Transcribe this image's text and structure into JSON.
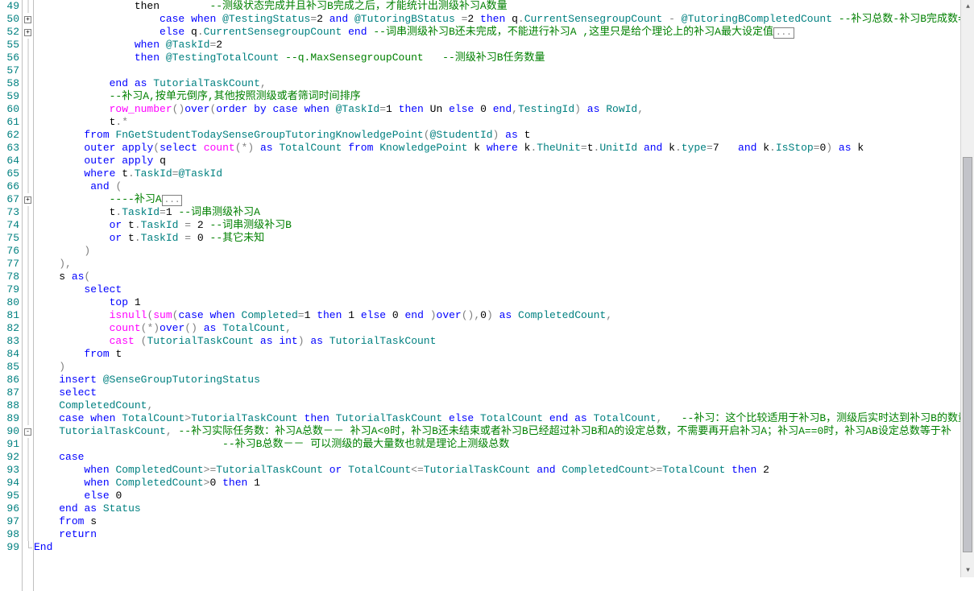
{
  "line_numbers": [
    "49",
    "50",
    "52",
    "55",
    "56",
    "57",
    "58",
    "59",
    "60",
    "61",
    "62",
    "63",
    "64",
    "65",
    "66",
    "67",
    "73",
    "74",
    "75",
    "76",
    "77",
    "78",
    "79",
    "80",
    "81",
    "82",
    "83",
    "84",
    "85",
    "86",
    "87",
    "88",
    "89",
    "90",
    "91",
    "92",
    "93",
    "94",
    "95",
    "96",
    "97",
    "98",
    "99"
  ],
  "fold": {
    "50": "plus",
    "52": "plus",
    "67": "plus",
    "90": "minus"
  },
  "code": {
    "l49": {
      "pre": "                then        ",
      "c1": "--测级状态完成并且补习B完成之后，才能统计出测级补习A数量"
    },
    "l50": {
      "pre": "                    ",
      "k1": "case",
      "t1": " ",
      "k2": "when",
      "t2": " ",
      "v1": "@TestingStatus",
      "o1": "=",
      "n1": "2",
      "t3": " ",
      "k3": "and",
      "t4": " ",
      "v2": "@TutoringBStatus",
      "t5": " ",
      "o2": "=",
      "n2": "2",
      "t6": " ",
      "k4": "then",
      "t7": " q",
      "o3": ".",
      "i1": "CurrentSensegroupCount",
      "t8": " ",
      "o4": "-",
      "t9": " ",
      "v3": "@TutoringBCompletedCount",
      "t10": " ",
      "c1": "--补习总数-补习B完成数= 测级补习A需要补"
    },
    "l52": {
      "pre": "                    ",
      "k1": "else",
      "t1": " q",
      "o1": ".",
      "i1": "CurrentSensegroupCount",
      "t2": " ",
      "k2": "end",
      "t3": " ",
      "c1": "--词串测级补习B还未完成，不能进行补习A ,这里只是给个理论上的补习A最大设定值",
      "box": "..."
    },
    "l55": {
      "pre": "                ",
      "k1": "when",
      "t1": " ",
      "v1": "@TaskId",
      "o1": "=",
      "n1": "2"
    },
    "l56": {
      "pre": "                ",
      "k1": "then",
      "t1": " ",
      "v1": "@TestingTotalCount",
      "t2": " ",
      "c1": "--q.MaxSensegroupCount   --测级补习B任务数量"
    },
    "l58": {
      "pre": "            ",
      "k1": "end",
      "t1": " ",
      "k2": "as",
      "t2": " ",
      "i1": "TutorialTaskCount",
      "o1": ","
    },
    "l59": {
      "pre": "            ",
      "c1": "--补习A,按单元倒序,其他按照测级或者筛词时间排序"
    },
    "l60": {
      "pre": "            ",
      "f1": "row_number",
      "o1": "()",
      "k1": "over",
      "o2": "(",
      "k2": "order",
      "t1": " ",
      "k3": "by",
      "t2": " ",
      "k4": "case",
      "t3": " ",
      "k5": "when",
      "t4": " ",
      "v1": "@TaskId",
      "o3": "=",
      "n1": "1",
      "t5": " ",
      "k6": "then",
      "t6": " Un ",
      "k7": "else",
      "t7": " ",
      "n2": "0",
      "t8": " ",
      "k8": "end",
      "o4": ",",
      "i1": "TestingId",
      "o5": ")",
      "t9": " ",
      "k9": "as",
      "t10": " ",
      "i2": "RowId",
      "o6": ","
    },
    "l61": {
      "pre": "            t",
      "o1": ".*"
    },
    "l62": {
      "pre": "        ",
      "k1": "from",
      "t1": " ",
      "i1": "FnGetStudentTodaySenseGroupTutoringKnowledgePoint",
      "o1": "(",
      "v1": "@StudentId",
      "o2": ")",
      "t2": " ",
      "k2": "as",
      "t3": " t"
    },
    "l63": {
      "pre": "        ",
      "k1": "outer",
      "t1": " ",
      "k2": "apply",
      "o1": "(",
      "k3": "select",
      "t2": " ",
      "f1": "count",
      "o2": "(*)",
      "t3": " ",
      "k4": "as",
      "t4": " ",
      "i1": "TotalCount",
      "t5": " ",
      "k5": "from",
      "t6": " ",
      "i2": "KnowledgePoint",
      "t7": " k ",
      "k6": "where",
      "t8": " k",
      "o3": ".",
      "i3": "TheUnit",
      "o4": "=",
      "t9": "t",
      "o5": ".",
      "i4": "UnitId",
      "t10": " ",
      "k7": "and",
      "t11": " k",
      "o6": ".",
      "i5": "type",
      "o7": "=",
      "n1": "7",
      "t12": "   ",
      "k8": "and",
      "t13": " k",
      "o8": ".",
      "i6": "IsStop",
      "o9": "=",
      "n2": "0",
      "o10": ")",
      "t14": " ",
      "k9": "as",
      "t15": " k"
    },
    "l64": {
      "pre": "        ",
      "k1": "outer",
      "t1": " ",
      "k2": "apply",
      "t2": " q"
    },
    "l65": {
      "pre": "        ",
      "k1": "where",
      "t1": " t",
      "o1": ".",
      "i1": "TaskId",
      "o2": "=",
      "v1": "@TaskId"
    },
    "l66": {
      "pre": "         ",
      "k1": "and",
      "t1": " ",
      "o1": "("
    },
    "l67": {
      "pre": "            ",
      "c1": "----补习A",
      "box": "..."
    },
    "l73": {
      "pre": "            t",
      "o1": ".",
      "i1": "TaskId",
      "o2": "=",
      "n1": "1",
      "t1": " ",
      "c1": "--词串测级补习A"
    },
    "l74": {
      "pre": "            ",
      "k1": "or",
      "t1": " t",
      "o1": ".",
      "i1": "TaskId",
      "t2": " ",
      "o2": "=",
      "t3": " ",
      "n1": "2",
      "t4": " ",
      "c1": "--词串测级补习B"
    },
    "l75": {
      "pre": "            ",
      "k1": "or",
      "t1": " t",
      "o1": ".",
      "i1": "TaskId",
      "t2": " ",
      "o2": "=",
      "t3": " ",
      "n1": "0",
      "t4": " ",
      "c1": "--其它未知"
    },
    "l76": {
      "pre": "        ",
      "o1": ")"
    },
    "l77": {
      "pre": "    ",
      "o1": "),"
    },
    "l78": {
      "pre": "    s ",
      "k1": "as",
      "o1": "("
    },
    "l79": {
      "pre": "        ",
      "k1": "select"
    },
    "l80": {
      "pre": "            ",
      "k1": "top",
      "t1": " ",
      "n1": "1"
    },
    "l81": {
      "pre": "            ",
      "f1": "isnull",
      "o1": "(",
      "f2": "sum",
      "o2": "(",
      "k1": "case",
      "t1": " ",
      "k2": "when",
      "t2": " ",
      "i1": "Completed",
      "o3": "=",
      "n1": "1",
      "t3": " ",
      "k3": "then",
      "t4": " ",
      "n2": "1",
      "t5": " ",
      "k4": "else",
      "t6": " ",
      "n3": "0",
      "t7": " ",
      "k5": "end",
      "t8": " ",
      "o4": ")",
      "k6": "over",
      "o5": "(),",
      "n4": "0",
      "o6": ")",
      "t9": " ",
      "k7": "as",
      "t10": " ",
      "i2": "CompletedCount",
      "o7": ","
    },
    "l82": {
      "pre": "            ",
      "f1": "count",
      "o1": "(*)",
      "k1": "over",
      "o2": "()",
      "t1": " ",
      "k2": "as",
      "t2": " ",
      "i1": "TotalCount",
      "o3": ","
    },
    "l83": {
      "pre": "            ",
      "f1": "cast",
      "t1": " ",
      "o1": "(",
      "i1": "TutorialTaskCount",
      "t2": " ",
      "k1": "as",
      "t3": " ",
      "k2": "int",
      "o2": ")",
      "t4": " ",
      "k3": "as",
      "t5": " ",
      "i2": "TutorialTaskCount"
    },
    "l84": {
      "pre": "        ",
      "k1": "from",
      "t1": " t"
    },
    "l85": {
      "pre": "    ",
      "o1": ")"
    },
    "l86": {
      "pre": "    ",
      "k1": "insert",
      "t1": " ",
      "v1": "@SenseGroupTutoringStatus"
    },
    "l87": {
      "pre": "    ",
      "k1": "select"
    },
    "l88": {
      "pre": "    ",
      "i1": "CompletedCount",
      "o1": ","
    },
    "l89": {
      "pre": "    ",
      "k1": "case",
      "t1": " ",
      "k2": "when",
      "t2": " ",
      "i1": "TotalCount",
      "o1": ">",
      "i2": "TutorialTaskCount",
      "t3": " ",
      "k3": "then",
      "t4": " ",
      "i3": "TutorialTaskCount",
      "t5": " ",
      "k4": "else",
      "t6": " ",
      "i4": "TotalCount",
      "t7": " ",
      "k5": "end",
      "t8": " ",
      "k6": "as",
      "t9": " ",
      "i5": "TotalCount",
      "o2": ",",
      "t10": "   ",
      "c1": "--补习：这个比较适用于补习B，测级后实时达到补习B的数量，包括任务"
    },
    "l90": {
      "pre": "    ",
      "i1": "TutorialTaskCount",
      "o1": ",",
      "t1": " ",
      "c1": "--补习实际任务数：补习A总数－－ 补习A<0时，补习B还未结束或者补习B已经超过补习B和A的设定总数，不需要再开启补习A；补习A==0时，补习AB设定总数等于补"
    },
    "l91": {
      "pre": "                              ",
      "c1": "--补习B总数－－ 可以测级的最大量数也就是理论上测级总数"
    },
    "l92": {
      "pre": "    ",
      "k1": "case"
    },
    "l93": {
      "pre": "        ",
      "k1": "when",
      "t1": " ",
      "i1": "CompletedCount",
      "o1": ">=",
      "i2": "TutorialTaskCount",
      "t2": " ",
      "k2": "or",
      "t3": " ",
      "i3": "TotalCount",
      "o2": "<=",
      "i4": "TutorialTaskCount",
      "t4": " ",
      "k3": "and",
      "t5": " ",
      "i5": "CompletedCount",
      "o3": ">=",
      "i6": "TotalCount",
      "t6": " ",
      "k4": "then",
      "t7": " ",
      "n1": "2"
    },
    "l94": {
      "pre": "        ",
      "k1": "when",
      "t1": " ",
      "i1": "CompletedCount",
      "o1": ">",
      "n1": "0",
      "t2": " ",
      "k2": "then",
      "t3": " ",
      "n2": "1"
    },
    "l95": {
      "pre": "        ",
      "k1": "else",
      "t1": " ",
      "n1": "0"
    },
    "l96": {
      "pre": "    ",
      "k1": "end",
      "t1": " ",
      "k2": "as",
      "t2": " ",
      "i1": "Status"
    },
    "l97": {
      "pre": "    ",
      "k1": "from",
      "t1": " s"
    },
    "l98": {
      "pre": "    ",
      "k1": "return"
    },
    "l99": {
      "k1": "End"
    }
  },
  "scrollbar": {
    "thumb_top_pct": 26,
    "thumb_height_pct": 72
  }
}
